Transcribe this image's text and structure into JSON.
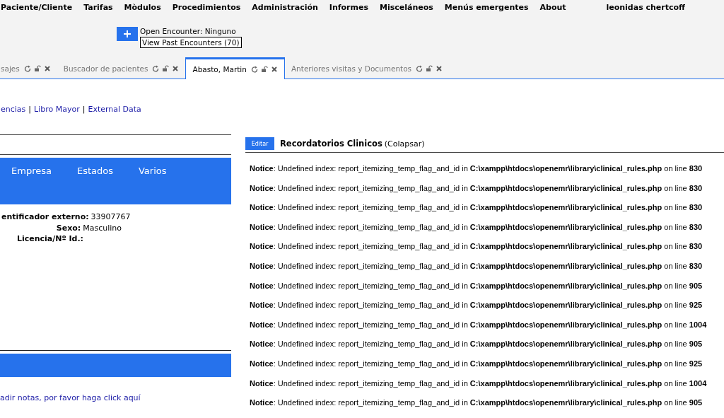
{
  "menu": [
    "Paciente/Cliente",
    "Tarifas",
    "Mòdulos",
    "Procedimientos",
    "Administración",
    "Informes",
    "Misceláneos",
    "Menús emergentes",
    "About"
  ],
  "user": "leonidas chertcoff",
  "encounter": {
    "open": "Open Encounter: Ninguno",
    "past": "View Past Encounters (70)"
  },
  "tabs": [
    {
      "label": "sajes",
      "selected": false
    },
    {
      "label": "Buscador de pacientes",
      "selected": false
    },
    {
      "label": "Abasto, Martin",
      "selected": true
    },
    {
      "label": "Anteriores visitas y Documentos",
      "selected": false
    }
  ],
  "links": [
    {
      "kind": "link",
      "text": "encias"
    },
    {
      "kind": "separator",
      "text": "|"
    },
    {
      "kind": "link",
      "text": "Libro Mayor"
    },
    {
      "kind": "separator",
      "text": "|"
    },
    {
      "kind": "link",
      "text": "External Data"
    }
  ],
  "demographics_tabs": [
    "Empresa",
    "Estados",
    "Varios"
  ],
  "fields": [
    {
      "label": "entificador externo:",
      "value": "33907767"
    },
    {
      "label": "Sexo:",
      "value": "Masculino"
    },
    {
      "label": "Licencia/Nº Id.:"
    }
  ],
  "notes_link": "adir notas, por favor haga click aquí",
  "reminders": {
    "button": "Editar",
    "title": "Recordatorios Clinicos",
    "toggle": "(Colapsar)",
    "notices": [
      "**Notice**: Undefined index: report_itemizing_temp_flag_and_id in **C:\\xampp\\htdocs\\openemr\\library\\clinical_rules.php** on line **830**",
      "**Notice**: Undefined index: report_itemizing_temp_flag_and_id in **C:\\xampp\\htdocs\\openemr\\library\\clinical_rules.php** on line **830**",
      "**Notice**: Undefined index: report_itemizing_temp_flag_and_id in **C:\\xampp\\htdocs\\openemr\\library\\clinical_rules.php** on line **830**",
      "**Notice**: Undefined index: report_itemizing_temp_flag_and_id in **C:\\xampp\\htdocs\\openemr\\library\\clinical_rules.php** on line **830**",
      "**Notice**: Undefined index: report_itemizing_temp_flag_and_id in **C:\\xampp\\htdocs\\openemr\\library\\clinical_rules.php** on line **830**",
      "**Notice**: Undefined index: report_itemizing_temp_flag_and_id in **C:\\xampp\\htdocs\\openemr\\library\\clinical_rules.php** on line **830**",
      "**Notice**: Undefined index: report_itemizing_temp_flag_and_id in **C:\\xampp\\htdocs\\openemr\\library\\clinical_rules.php** on line **905**",
      "**Notice**: Undefined index: report_itemizing_temp_flag_and_id in **C:\\xampp\\htdocs\\openemr\\library\\clinical_rules.php** on line **925**",
      "**Notice**: Undefined index: report_itemizing_temp_flag_and_id in **C:\\xampp\\htdocs\\openemr\\library\\clinical_rules.php** on line **1004**",
      "**Notice**: Undefined index: report_itemizing_temp_flag_and_id in **C:\\xampp\\htdocs\\openemr\\library\\clinical_rules.php** on line **905**",
      "**Notice**: Undefined index: report_itemizing_temp_flag_and_id in **C:\\xampp\\htdocs\\openemr\\library\\clinical_rules.php** on line **925**",
      "**Notice**: Undefined index: report_itemizing_temp_flag_and_id in **C:\\xampp\\htdocs\\openemr\\library\\clinical_rules.php** on line **1004**",
      "**Notice**: Undefined index: report_itemizing_temp_flag_and_id in **C:\\xampp\\htdocs\\openemr\\library\\clinical_rules.php** on line **905**"
    ]
  }
}
